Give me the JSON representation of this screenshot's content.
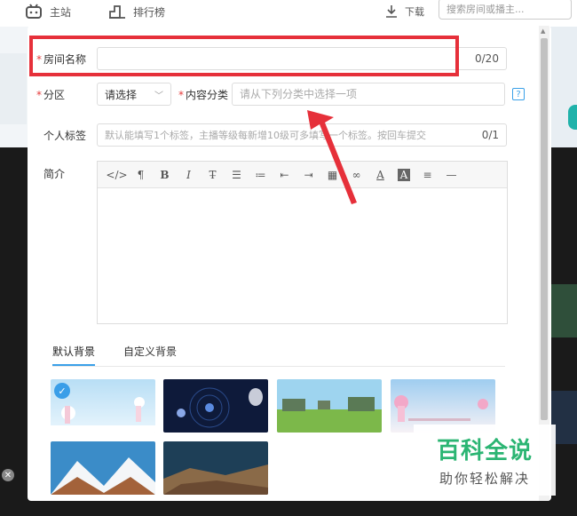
{
  "nav": {
    "home_label": "主站",
    "rank_label": "排行榜",
    "download_label": "下载",
    "search_placeholder": "搜索房间或播主..."
  },
  "form": {
    "room_name": {
      "label": "房间名称",
      "value": "",
      "counter": "0/20"
    },
    "area": {
      "label": "分区",
      "selected": "请选择"
    },
    "content_category": {
      "label": "内容分类",
      "placeholder": "请从下列分类中选择一项",
      "help": "?"
    },
    "tags": {
      "label": "个人标签",
      "placeholder": "默认能填写1个标签，主播等级每新增10级可多填写一个标签。按回车提交",
      "counter": "0/1"
    },
    "intro": {
      "label": "简介"
    }
  },
  "editor_tools": [
    {
      "name": "code-icon",
      "glyph": "</>"
    },
    {
      "name": "paragraph-icon",
      "glyph": "¶"
    },
    {
      "name": "bold-icon",
      "glyph": "B"
    },
    {
      "name": "italic-icon",
      "glyph": "I"
    },
    {
      "name": "strikethrough-icon",
      "glyph": "T̶"
    },
    {
      "name": "bullet-list-icon",
      "glyph": "☰"
    },
    {
      "name": "numbered-list-icon",
      "glyph": "≔"
    },
    {
      "name": "outdent-icon",
      "glyph": "⇤"
    },
    {
      "name": "indent-icon",
      "glyph": "⇥"
    },
    {
      "name": "table-icon",
      "glyph": "▦"
    },
    {
      "name": "link-icon",
      "glyph": "∞"
    },
    {
      "name": "font-color-icon",
      "glyph": "A"
    },
    {
      "name": "background-color-icon",
      "glyph": "A"
    },
    {
      "name": "align-icon",
      "glyph": "≡"
    },
    {
      "name": "horizontal-rule-icon",
      "glyph": "—"
    }
  ],
  "background_tabs": {
    "default_label": "默认背景",
    "custom_label": "自定义背景"
  },
  "watermark": {
    "main": "百科全说",
    "sub": "助你轻松解决"
  },
  "colors": {
    "accent": "#3aa0e8",
    "required": "#e63b3b",
    "highlight_box": "#e6303a",
    "watermark_green": "#2bb573"
  }
}
